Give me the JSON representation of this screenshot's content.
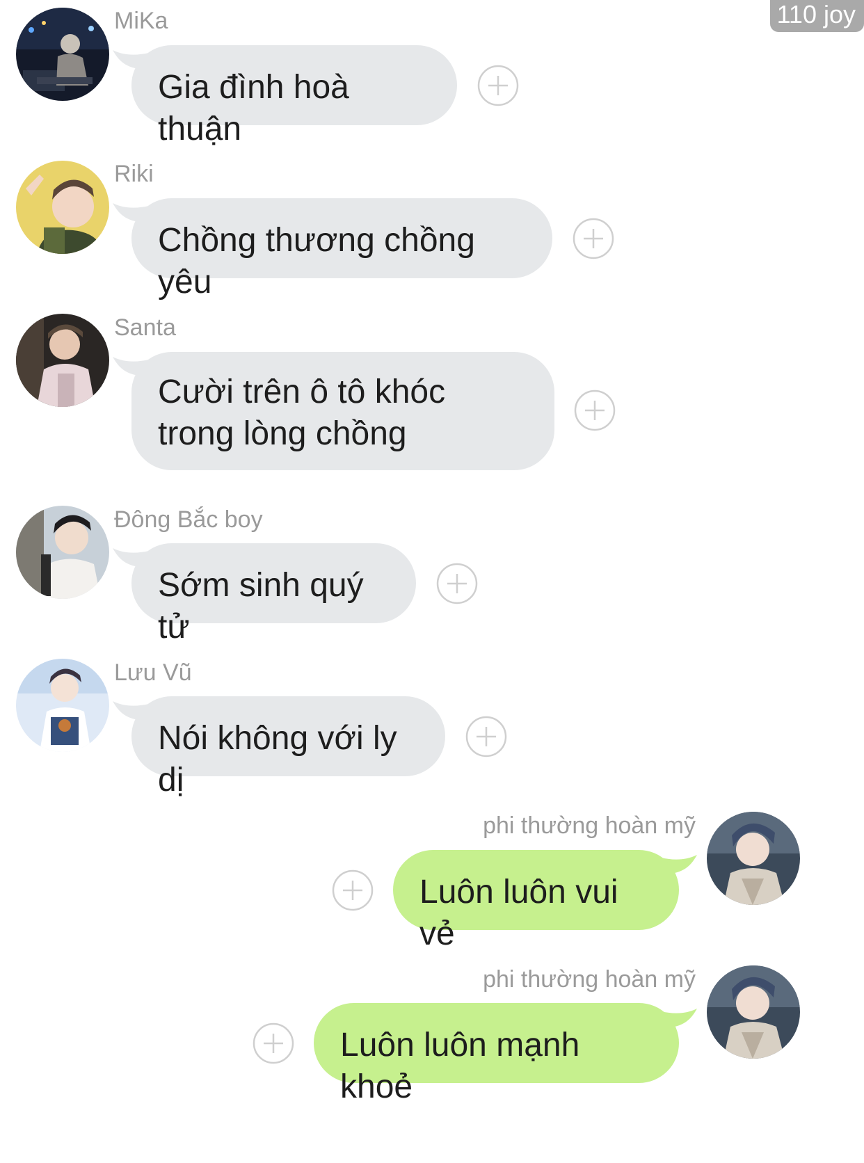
{
  "badge": "110 joy",
  "messages": [
    {
      "sender": "MiKa",
      "text": "Gia đình hoà thuận",
      "side": "in"
    },
    {
      "sender": "Riki",
      "text": "Chồng thương chồng yêu",
      "side": "in"
    },
    {
      "sender": "Santa",
      "text": "Cười trên ô tô khóc trong lòng chồng",
      "side": "in"
    },
    {
      "sender": "Đông Bắc boy",
      "text": "Sớm sinh quý tử",
      "side": "in"
    },
    {
      "sender": "Lưu Vũ",
      "text": "Nói không với ly dị",
      "side": "in"
    },
    {
      "sender": "phi thường hoàn mỹ",
      "text": "Luôn luôn vui vẻ",
      "side": "out"
    },
    {
      "sender": "phi thường hoàn mỹ",
      "text": "Luôn luôn mạnh khoẻ",
      "side": "out"
    }
  ],
  "colors": {
    "incoming_bubble": "#e6e8ea",
    "outgoing_bubble": "#c6f08e",
    "sender_name": "#9a9a9a",
    "badge_bg": "#a9a9a9"
  },
  "icons": {
    "reaction": "plus-circle-icon",
    "avatar": "user-avatar"
  }
}
